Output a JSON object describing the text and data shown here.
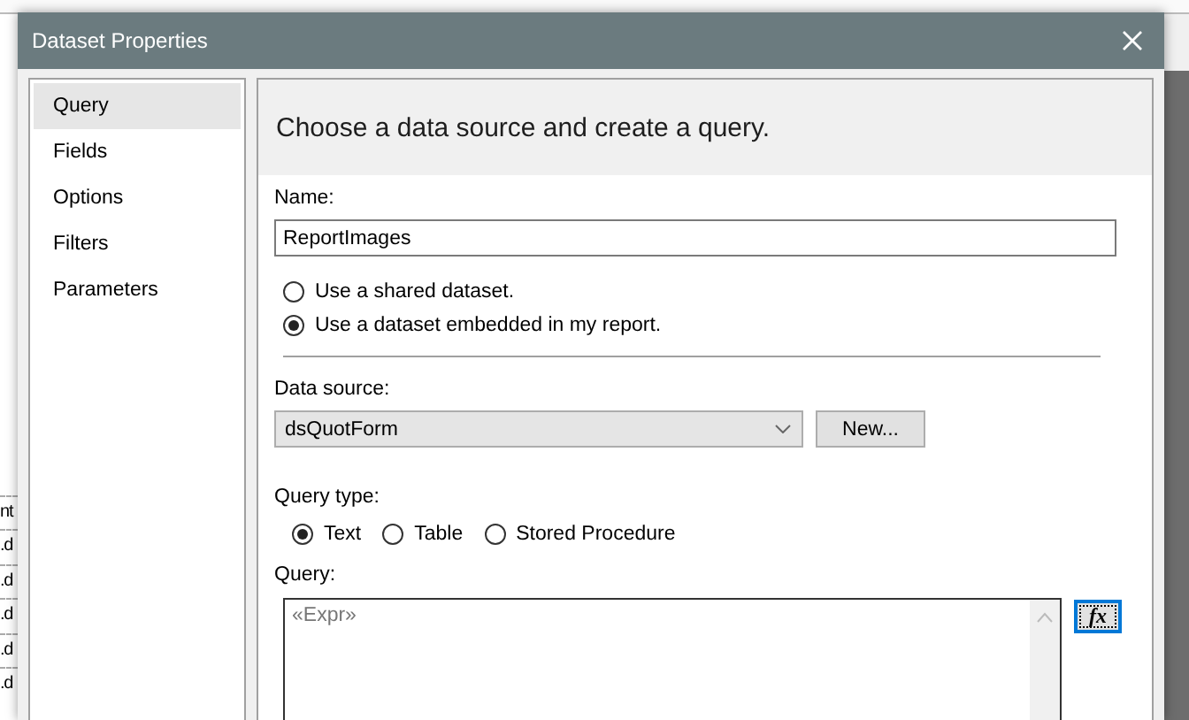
{
  "background_app": {
    "fragments": [
      "nt",
      ".d",
      ".d",
      ".d",
      ".d",
      ".d"
    ]
  },
  "window": {
    "title": "Dataset Properties"
  },
  "sidebar": {
    "items": [
      {
        "label": "Query",
        "selected": true
      },
      {
        "label": "Fields",
        "selected": false
      },
      {
        "label": "Options",
        "selected": false
      },
      {
        "label": "Filters",
        "selected": false
      },
      {
        "label": "Parameters",
        "selected": false
      }
    ]
  },
  "page": {
    "heading": "Choose a data source and create a query.",
    "name": {
      "label": "Name:",
      "value": "ReportImages"
    },
    "dataset_options": [
      {
        "label": "Use a shared dataset.",
        "selected": false
      },
      {
        "label": "Use a dataset embedded in my report.",
        "selected": true
      }
    ],
    "data_source": {
      "label": "Data source:",
      "value": "dsQuotForm",
      "new_button": "New..."
    },
    "query_type": {
      "label": "Query type:",
      "options": [
        {
          "label": "Text",
          "selected": true
        },
        {
          "label": "Table",
          "selected": false
        },
        {
          "label": "Stored Procedure",
          "selected": false
        }
      ]
    },
    "query": {
      "label": "Query:",
      "value": "«Expr»",
      "expression_button": "fx"
    }
  }
}
